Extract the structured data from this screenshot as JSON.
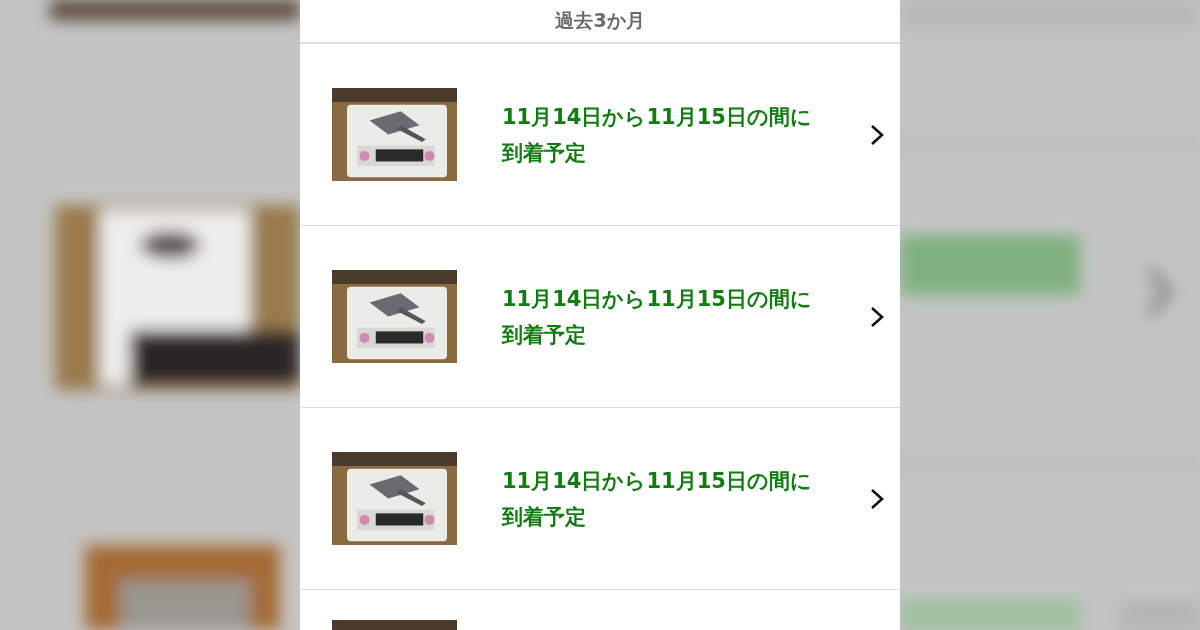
{
  "background": {
    "kind": "picture"
  },
  "header": {
    "title": "過去3か月"
  },
  "orders": [
    {
      "image": {
        "kind": "picture"
      },
      "delivery": "11月14日から11月15日の間に到着予定"
    },
    {
      "image": {
        "kind": "picture"
      },
      "delivery": "11月14日から11月15日の間に到着予定"
    },
    {
      "image": {
        "kind": "picture"
      },
      "delivery": "11月14日から11月15日の間に到着予定"
    },
    {
      "image": {
        "kind": "picture"
      }
    }
  ]
}
